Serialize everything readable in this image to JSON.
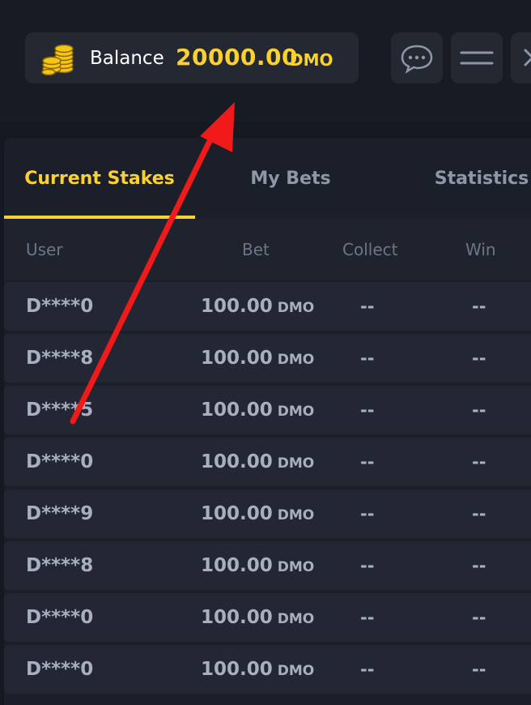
{
  "header": {
    "balance_label": "Balance",
    "balance_value": "20000.00",
    "balance_currency": "DMO"
  },
  "tabs": [
    {
      "label": "Current Stakes",
      "active": true
    },
    {
      "label": "My Bets",
      "active": false
    },
    {
      "label": "Statistics",
      "active": false
    }
  ],
  "table": {
    "columns": [
      "User",
      "Bet",
      "Collect",
      "Win"
    ],
    "rows": [
      {
        "user": "D****0",
        "bet": "100.00",
        "currency": "DMO",
        "collect": "--",
        "win": "--"
      },
      {
        "user": "D****8",
        "bet": "100.00",
        "currency": "DMO",
        "collect": "--",
        "win": "--"
      },
      {
        "user": "D****5",
        "bet": "100.00",
        "currency": "DMO",
        "collect": "--",
        "win": "--"
      },
      {
        "user": "D****0",
        "bet": "100.00",
        "currency": "DMO",
        "collect": "--",
        "win": "--"
      },
      {
        "user": "D****9",
        "bet": "100.00",
        "currency": "DMO",
        "collect": "--",
        "win": "--"
      },
      {
        "user": "D****8",
        "bet": "100.00",
        "currency": "DMO",
        "collect": "--",
        "win": "--"
      },
      {
        "user": "D****0",
        "bet": "100.00",
        "currency": "DMO",
        "collect": "--",
        "win": "--"
      },
      {
        "user": "D****0",
        "bet": "100.00",
        "currency": "DMO",
        "collect": "--",
        "win": "--"
      }
    ]
  },
  "colors": {
    "accent": "#fbd130",
    "annotation_arrow": "#f01a1a",
    "background": "#141821"
  },
  "icons": [
    "coins-icon",
    "chat-icon",
    "menu-icon",
    "close-icon"
  ]
}
